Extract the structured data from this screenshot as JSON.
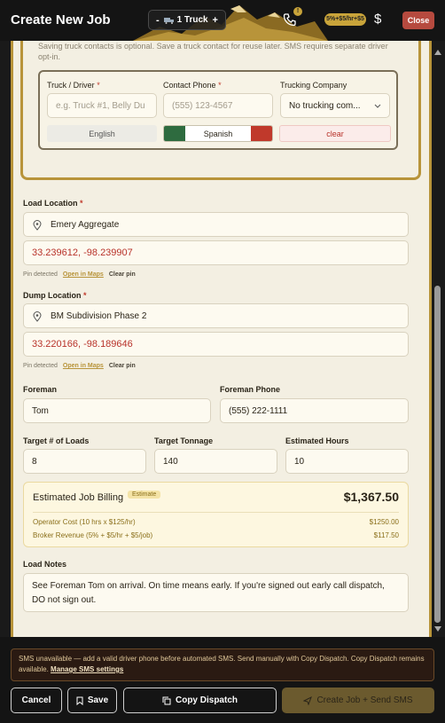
{
  "header": {
    "title": "Create New Job",
    "truck_minus": "-",
    "truck_label": "1 Truck",
    "truck_plus": "+",
    "phone_badge": "!",
    "fee_pill": "5%+$5/hr+$5",
    "dollar": "$",
    "close": "Close"
  },
  "contact": {
    "note": "Saving truck contacts is optional. Save a truck contact for reuse later. SMS requires separate driver opt-in.",
    "truck_label": "Truck / Driver",
    "truck_placeholder": "e.g. Truck #1, Belly Du",
    "phone_label": "Contact Phone",
    "phone_placeholder": "(555) 123-4567",
    "company_label": "Trucking Company",
    "company_value": "No trucking com...",
    "required_mark": "*",
    "lang_english": "English",
    "lang_spanish": "Spanish",
    "clear": "clear"
  },
  "load": {
    "label": "Load Location",
    "value": "Emery Aggregate",
    "coords": "33.239612, -98.239907",
    "pin_detected": "Pin detected",
    "open_maps": "Open in Maps",
    "clear_pin": "Clear pin"
  },
  "dump": {
    "label": "Dump Location",
    "value": "BM Subdivision Phase 2",
    "coords": "33.220166, -98.189646",
    "pin_detected": "Pin detected",
    "open_maps": "Open in Maps",
    "clear_pin": "Clear pin"
  },
  "foreman": {
    "label": "Foreman",
    "value": "Tom"
  },
  "foreman_phone": {
    "label": "Foreman Phone",
    "value": "(555) 222-1111"
  },
  "targets": {
    "loads_label": "Target # of Loads",
    "loads_value": "8",
    "tonnage_label": "Target Tonnage",
    "tonnage_value": "140",
    "hours_label": "Estimated Hours",
    "hours_value": "10"
  },
  "billing": {
    "title": "Estimated Job Billing",
    "badge": "Estimate",
    "total": "$1,367.50",
    "operator_label": "Operator Cost (10 hrs x $125/hr)",
    "operator_value": "$1250.00",
    "broker_label": "Broker Revenue (5% + $5/hr + $5/job)",
    "broker_value": "$117.50"
  },
  "notes": {
    "label": "Load Notes",
    "value": "See Foreman Tom on arrival. On time means early. If you're signed out early call dispatch, DO not sign out."
  },
  "footer": {
    "sms_warning": "SMS unavailable — add a valid driver phone before automated SMS. Send manually with Copy Dispatch. Copy Dispatch remains available.",
    "manage_sms": "Manage SMS settings",
    "cancel": "Cancel",
    "save": "Save",
    "copy_dispatch": "Copy Dispatch",
    "create_send": "Create Job + Send SMS"
  },
  "colors": {
    "accent_gold": "#b8943a",
    "danger": "#c0392b",
    "close_button": "#b64a3f",
    "header_bg": "#141414"
  }
}
